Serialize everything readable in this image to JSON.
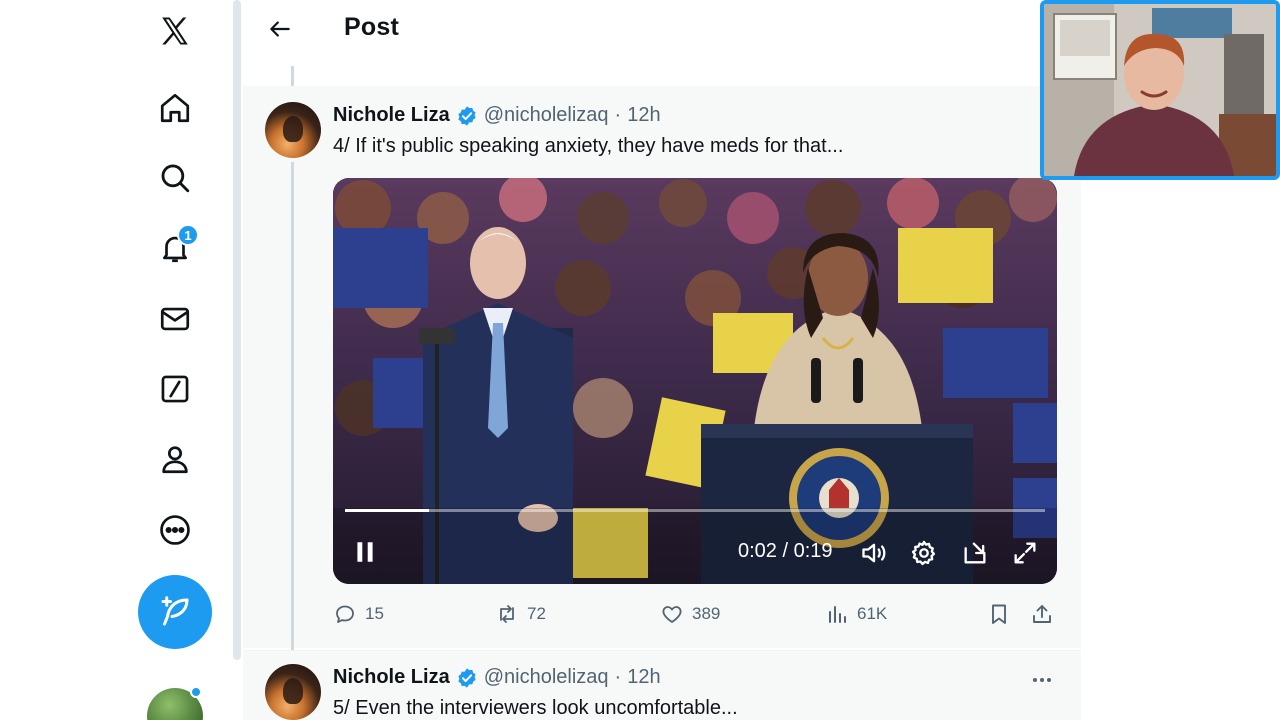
{
  "nav": {
    "logo": "x-logo-icon",
    "items": [
      {
        "name": "home",
        "icon": "home-icon"
      },
      {
        "name": "explore",
        "icon": "search-icon"
      },
      {
        "name": "notifications",
        "icon": "bell-icon",
        "badge": "1"
      },
      {
        "name": "messages",
        "icon": "mail-icon"
      },
      {
        "name": "grok",
        "icon": "slash-box-icon"
      },
      {
        "name": "profile",
        "icon": "person-icon"
      },
      {
        "name": "more",
        "icon": "more-circle-icon"
      }
    ],
    "compose_icon": "feather-plus-icon"
  },
  "header": {
    "title": "Post",
    "back_icon": "arrow-left-icon"
  },
  "tweets": [
    {
      "name": "Nichole Liza",
      "handle": "@nicholelizaq",
      "separator": "·",
      "time": "12h",
      "text": "4/ If it's public speaking anxiety, they have meds for that...",
      "video": {
        "time_display": "0:02 / 0:19",
        "progress": 0.12
      },
      "actions": {
        "replies": "15",
        "reposts": "72",
        "likes": "389",
        "views": "61K"
      }
    },
    {
      "name": "Nichole Liza",
      "handle": "@nicholelizaq",
      "separator": "·",
      "time": "12h",
      "text": "5/ Even the interviewers look uncomfortable..."
    }
  ],
  "colors": {
    "accent": "#1d9bf0",
    "text": "#0f1419",
    "muted": "#536471"
  }
}
